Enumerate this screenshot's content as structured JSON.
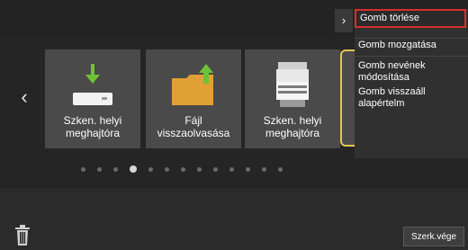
{
  "tiles": [
    {
      "label_line1": "Szken. helyi",
      "label_line2": "meghajtóra",
      "icon": "usb-drive-download-icon"
    },
    {
      "label_line1": "Fájl",
      "label_line2": "visszaolvasása",
      "icon": "folder-upload-icon"
    },
    {
      "label_line1": "Szken. helyi",
      "label_line2": "meghajtóra",
      "icon": "printer-scanner-icon"
    }
  ],
  "context_menu": {
    "items": [
      {
        "label": "Gomb törlése",
        "selected": true
      },
      {
        "label": "Gomb mozgatása"
      },
      {
        "label_line1": "Gomb nevének",
        "label_line2": "módosítása"
      },
      {
        "label_line1": "Gomb visszaáll",
        "label_line2": "alapértelm"
      }
    ]
  },
  "pager": {
    "count": 13,
    "active_index": 3
  },
  "footer": {
    "done_label": "Szerk.vége"
  },
  "colors": {
    "highlight": "#d92e2e",
    "tile_border_accent": "#e7c64f",
    "tile_bg": "#4a4a4a"
  }
}
